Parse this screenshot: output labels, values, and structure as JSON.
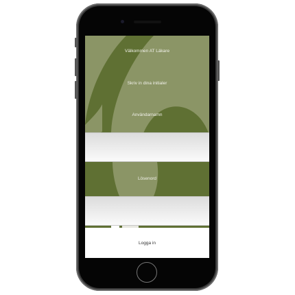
{
  "login_screen": {
    "welcome": "Välkommen AT Läkare",
    "instruction": "Skriv in dina initialer",
    "username_label": "Användarnamn",
    "username_value": "",
    "password_label": "Lösenord",
    "password_value": "",
    "login_button": "Logga in"
  },
  "colors": {
    "background": "#8b9566",
    "accent_dark_green": "#5f7033"
  }
}
